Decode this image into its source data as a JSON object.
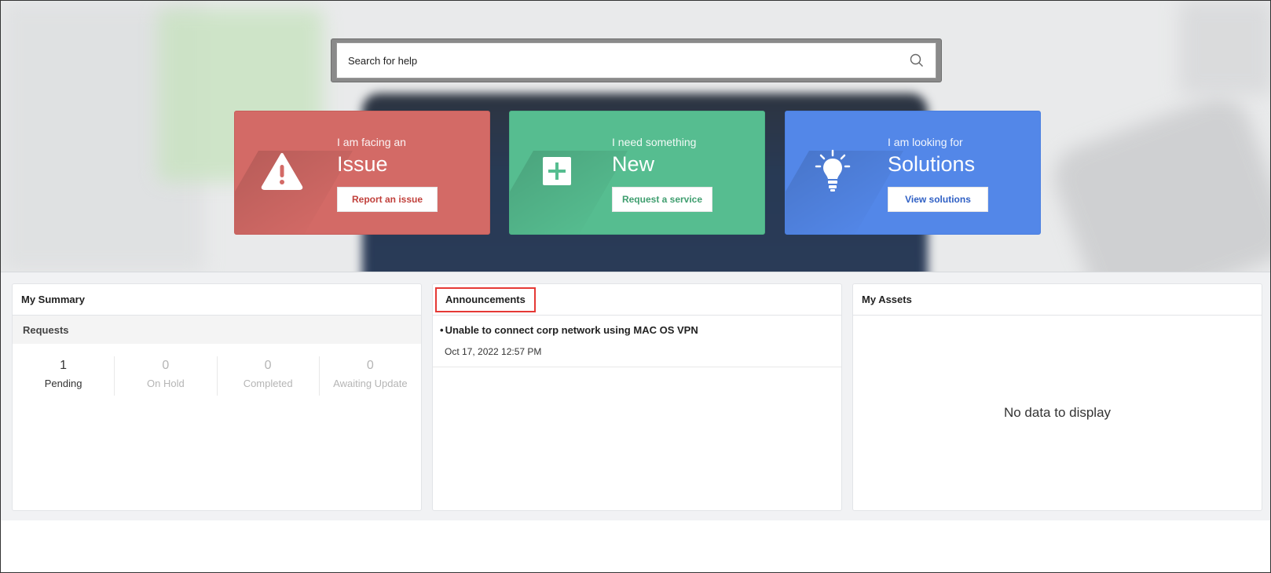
{
  "search": {
    "placeholder": "Search for help"
  },
  "cards": [
    {
      "subtitle": "I am facing an",
      "title": "Issue",
      "button": "Report an issue",
      "icon": "warning-icon",
      "color": "#d36a66"
    },
    {
      "subtitle": "I need something",
      "title": "New",
      "button": "Request a service",
      "icon": "plus-icon",
      "color": "#56bd90"
    },
    {
      "subtitle": "I am looking for",
      "title": "Solutions",
      "button": "View solutions",
      "icon": "lightbulb-icon",
      "color": "#5387e8"
    }
  ],
  "summary": {
    "title": "My Summary",
    "section": "Requests",
    "stats": [
      {
        "value": "1",
        "label": "Pending"
      },
      {
        "value": "0",
        "label": "On Hold"
      },
      {
        "value": "0",
        "label": "Completed"
      },
      {
        "value": "0",
        "label": "Awaiting Update"
      }
    ]
  },
  "announcements": {
    "title": "Announcements",
    "items": [
      {
        "bullet": "•",
        "title": "Unable to connect corp network using MAC OS VPN",
        "date": "Oct 17, 2022 12:57 PM"
      }
    ]
  },
  "assets": {
    "title": "My Assets",
    "empty": "No data to display"
  }
}
